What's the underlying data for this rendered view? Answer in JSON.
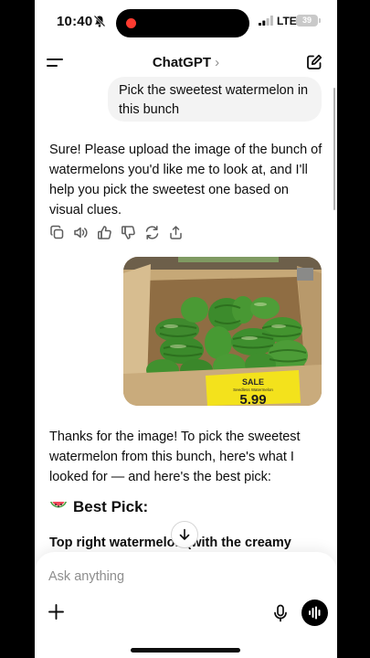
{
  "status_bar": {
    "time": "10:40",
    "network": "LTE",
    "battery": "39"
  },
  "nav": {
    "title": "ChatGPT",
    "chevron": "›"
  },
  "conversation": {
    "user_message": "Pick the sweetest watermelon in this bunch",
    "assistant_reply_1": "Sure! Please upload the image of the bunch of watermelons you'd like me to look at, and I'll help you pick the sweetest one based on visual clues.",
    "photo_sign": {
      "top": "SALE",
      "small": "Seedless Watermelon",
      "price": "5.99"
    },
    "assistant_reply_2": "Thanks for the image! To pick the sweetest watermelon from this bunch, here's what I looked for — and here's the best pick:",
    "best_pick_heading": "Best Pick:",
    "best_pick_detail": "Top right watermelon (with the creamy"
  },
  "composer": {
    "placeholder": "Ask anything"
  },
  "icons": [
    "bell-slash-icon",
    "signal-icon",
    "menu-icon",
    "compose-icon",
    "copy-icon",
    "speaker-icon",
    "thumbs-up-icon",
    "thumbs-down-icon",
    "regenerate-icon",
    "share-icon",
    "watermelon-icon",
    "arrow-down-icon",
    "plus-icon",
    "microphone-icon",
    "voice-mode-icon"
  ],
  "colors": {
    "record_dot": "#ff3b30",
    "user_bubble": "#f3f3f3",
    "text": "#0d0d0d",
    "placeholder": "#8e8e8e"
  }
}
